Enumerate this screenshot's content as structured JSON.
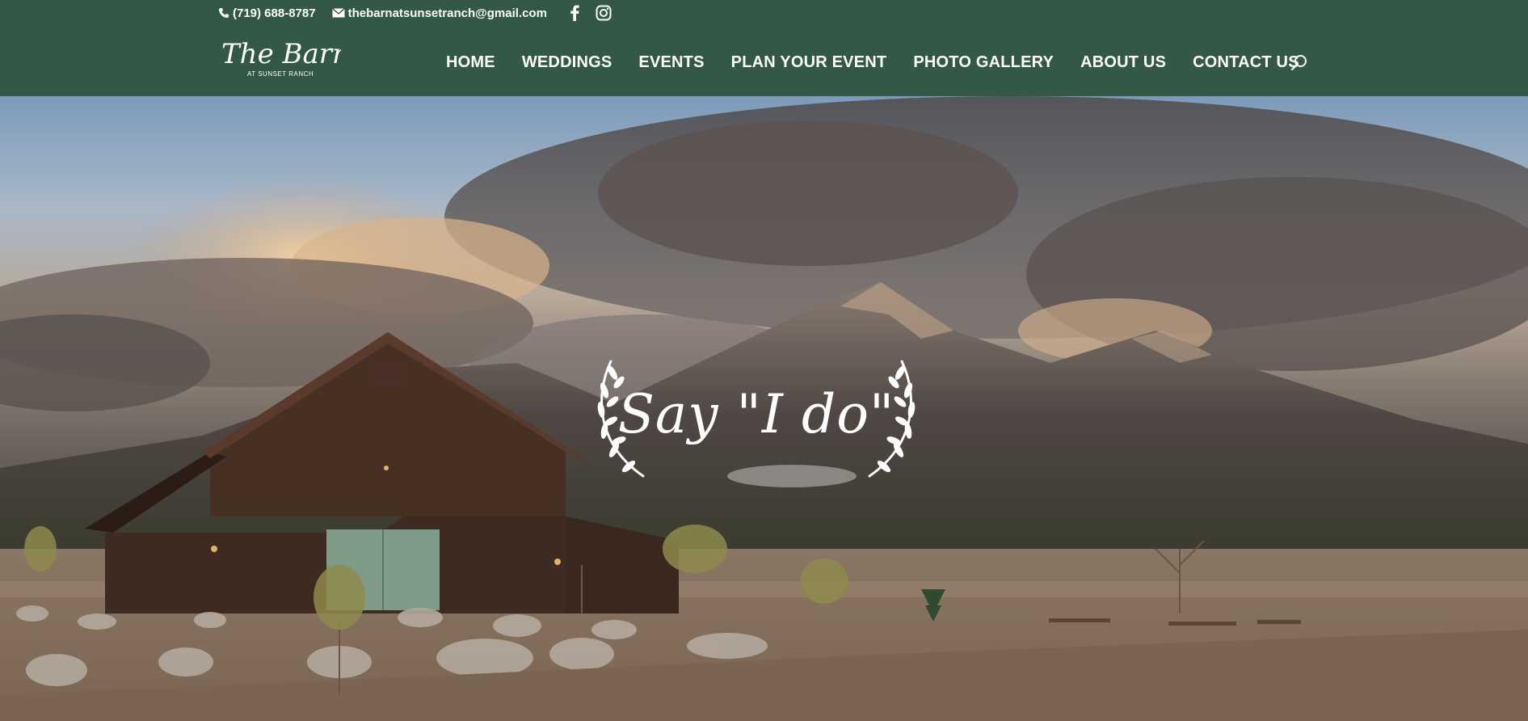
{
  "contact": {
    "phone": "(719) 688-8787",
    "email": "thebarnatsunsetranch@gmail.com",
    "phone_icon": "phone-icon",
    "email_icon": "envelope-icon",
    "social": [
      "facebook-icon",
      "instagram-icon"
    ]
  },
  "brand": {
    "name": "The Barn",
    "sub": "AT SUNSET RANCH"
  },
  "nav": {
    "items": [
      "HOME",
      "WEDDINGS",
      "EVENTS",
      "PLAN YOUR EVENT",
      "PHOTO GALLERY",
      "ABOUT US",
      "CONTACT US"
    ],
    "search_icon": "search-icon"
  },
  "hero": {
    "tagline": "Say \"I do\""
  },
  "colors": {
    "header_bg": "#335845",
    "text": "#ffffff"
  }
}
